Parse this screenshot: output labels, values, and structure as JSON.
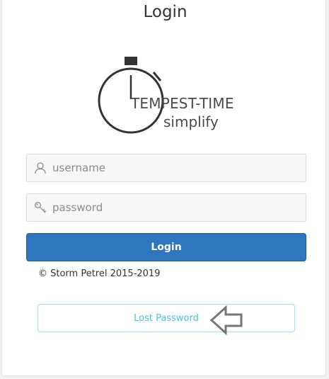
{
  "header": {
    "title": "Login"
  },
  "logo": {
    "name": "TEMPEST-TIME",
    "tagline": "simplify",
    "icon": "stopwatch-icon"
  },
  "form": {
    "username": {
      "placeholder": "username",
      "value": "",
      "icon": "user-icon"
    },
    "password": {
      "placeholder": "password",
      "value": "",
      "icon": "key-icon"
    },
    "login_label": "Login"
  },
  "footer": {
    "copyright": "© Storm Petrel 2015-2019"
  },
  "lost_password_label": "Lost Password",
  "annotation": {
    "icon": "left-arrow-icon"
  },
  "colors": {
    "primary": "#2e76bd",
    "lost_border": "#9fe3f3",
    "lost_text": "#3ec6e6",
    "field_bg": "#f8f8f8"
  }
}
